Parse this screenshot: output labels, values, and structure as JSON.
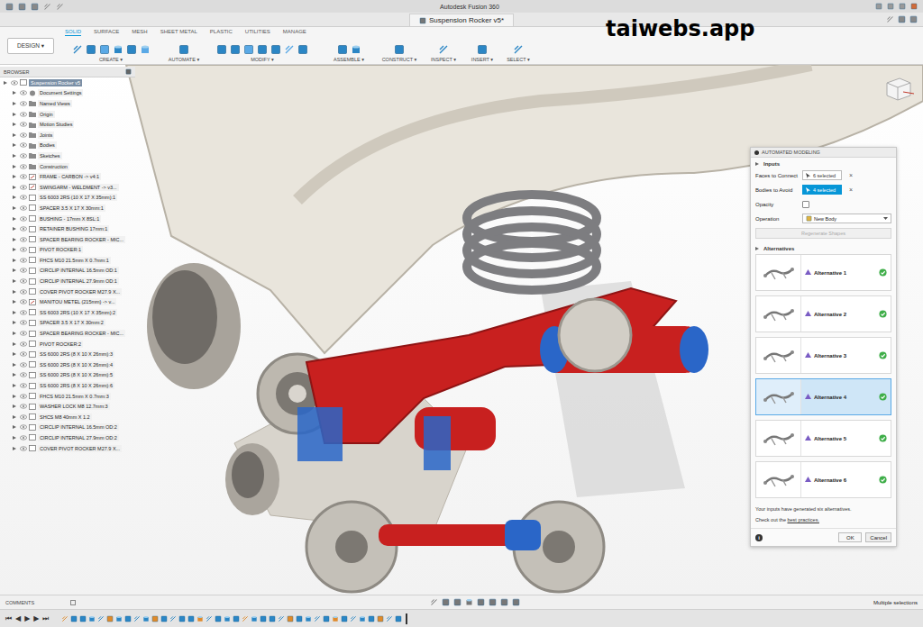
{
  "window": {
    "title": "Autodesk Fusion 360"
  },
  "document_tab": {
    "label": "Suspension Rocker v5*"
  },
  "watermark": "taiwebs.app",
  "toolbar": {
    "workspace": "DESIGN ▾",
    "tabs": [
      {
        "label": "SOLID",
        "selected": true
      },
      {
        "label": "SURFACE",
        "selected": false
      },
      {
        "label": "MESH",
        "selected": false
      },
      {
        "label": "SHEET METAL",
        "selected": false
      },
      {
        "label": "PLASTIC",
        "selected": false
      },
      {
        "label": "UTILITIES",
        "selected": false
      },
      {
        "label": "MANAGE",
        "selected": false
      }
    ],
    "groups": [
      {
        "label": "CREATE ▾"
      },
      {
        "label": "AUTOMATE ▾"
      },
      {
        "label": "MODIFY ▾"
      },
      {
        "label": "ASSEMBLE ▾"
      },
      {
        "label": "CONSTRUCT ▾"
      },
      {
        "label": "INSPECT ▾"
      },
      {
        "label": "INSERT ▾"
      },
      {
        "label": "SELECT ▾"
      }
    ]
  },
  "browser": {
    "title": "BROWSER",
    "items": [
      {
        "label": "Suspension Rocker v5",
        "kind": "root",
        "selected": true
      },
      {
        "label": "Document Settings",
        "kind": "settings",
        "selected": false
      },
      {
        "label": "Named Views",
        "kind": "folder",
        "selected": false
      },
      {
        "label": "Origin",
        "kind": "folder",
        "selected": false
      },
      {
        "label": "Motion Studies",
        "kind": "folder",
        "selected": false
      },
      {
        "label": "Joints",
        "kind": "folder",
        "selected": false
      },
      {
        "label": "Bodies",
        "kind": "folder",
        "selected": false
      },
      {
        "label": "Sketches",
        "kind": "folder",
        "selected": false
      },
      {
        "label": "Construction",
        "kind": "folder",
        "selected": false
      },
      {
        "label": "FRAME - CARBON -> v4:1",
        "kind": "link",
        "selected": false
      },
      {
        "label": "SWINGARM - WELDMENT -> v3...",
        "kind": "link",
        "selected": false
      },
      {
        "label": "SS 6003 2RS (10 X 17 X 35mm):1",
        "kind": "component",
        "selected": false
      },
      {
        "label": "SPACER 3.5 X 17 X 30mm:1",
        "kind": "component",
        "selected": false
      },
      {
        "label": "BUSHING - 17mm X 8SL:1",
        "kind": "component",
        "selected": false
      },
      {
        "label": "RETAINER BUSHING 17mm:1",
        "kind": "component",
        "selected": false
      },
      {
        "label": "SPACER BEARING ROCKER - MIC...",
        "kind": "component",
        "selected": false
      },
      {
        "label": "PIVOT ROCKER:1",
        "kind": "component",
        "selected": false
      },
      {
        "label": "FHCS M10 21.5mm X 0.7mm:1",
        "kind": "component",
        "selected": false
      },
      {
        "label": "CIRCLIP INTERNAL 16.5mm OD:1",
        "kind": "component",
        "selected": false
      },
      {
        "label": "CIRCLIP INTERNAL 27.9mm OD:1",
        "kind": "component",
        "selected": false
      },
      {
        "label": "COVER PIVOT ROCKER M27.9 X...",
        "kind": "component",
        "selected": false
      },
      {
        "label": "MANITOU METEL (215mm) -> v...",
        "kind": "link",
        "selected": false
      },
      {
        "label": "SS 6003 2RS (10 X 17 X 35mm):2",
        "kind": "component",
        "selected": false
      },
      {
        "label": "SPACER 3.5 X 17 X 30mm:2",
        "kind": "component",
        "selected": false
      },
      {
        "label": "SPACER BEARING ROCKER - MIC...",
        "kind": "component",
        "selected": false
      },
      {
        "label": "PIVOT ROCKER:2",
        "kind": "component",
        "selected": false
      },
      {
        "label": "SS 6000 2RS (8 X 10 X 26mm):3",
        "kind": "component",
        "selected": false
      },
      {
        "label": "SS 6000 2RS (8 X 10 X 26mm):4",
        "kind": "component",
        "selected": false
      },
      {
        "label": "SS 6000 2RS (8 X 10 X 26mm):5",
        "kind": "component",
        "selected": false
      },
      {
        "label": "SS 6000 2RS (8 X 10 X 26mm):6",
        "kind": "component",
        "selected": false
      },
      {
        "label": "FHCS M10 21.5mm X 0.7mm:3",
        "kind": "component",
        "selected": false
      },
      {
        "label": "WASHER LOCK M8 12.7mm:3",
        "kind": "component",
        "selected": false
      },
      {
        "label": "SHCS M8 40mm X 1.2",
        "kind": "component",
        "selected": false
      },
      {
        "label": "CIRCLIP INTERNAL 16.5mm OD:2",
        "kind": "component",
        "selected": false
      },
      {
        "label": "CIRCLIP INTERNAL 27.9mm OD:2",
        "kind": "component",
        "selected": false
      },
      {
        "label": "COVER PIVOT ROCKER M27.9 X...",
        "kind": "component",
        "selected": false
      }
    ]
  },
  "automated_modeling": {
    "title": "AUTOMATED MODELING",
    "inputs_title": "Inputs",
    "inputs": [
      {
        "label": "Faces to Connect",
        "kind": "selection",
        "value": "6 selected",
        "selected": false,
        "clear": "×"
      },
      {
        "label": "Bodies to Avoid",
        "kind": "selection",
        "value": "4 selected",
        "selected": true,
        "clear": "×"
      },
      {
        "label": "Opacity",
        "kind": "checkbox",
        "checked": false
      },
      {
        "label": "Operation",
        "kind": "dropdown",
        "value": "New Body"
      }
    ],
    "regenerate": {
      "label": "Regenerate Shapes",
      "disabled": true
    },
    "alternatives_title": "Alternatives",
    "alternatives": [
      {
        "label": "Alternative 1",
        "selected": false,
        "done": true
      },
      {
        "label": "Alternative 2",
        "selected": false,
        "done": true
      },
      {
        "label": "Alternative 3",
        "selected": false,
        "done": true
      },
      {
        "label": "Alternative 4",
        "selected": true,
        "done": true
      },
      {
        "label": "Alternative 5",
        "selected": false,
        "done": true
      },
      {
        "label": "Alternative 6",
        "selected": false,
        "done": true
      }
    ],
    "message": "Your inputs have generated six alternatives.",
    "hint": "Check out the ",
    "hint_link": "best practices.",
    "info": "i",
    "buttons": [
      {
        "label": "OK",
        "primary": true
      },
      {
        "label": "Cancel",
        "primary": false
      }
    ]
  },
  "comments": {
    "label": "COMMENTS"
  },
  "status": "Multiple selections",
  "timeline": {
    "controls": [
      "⏮",
      "◀",
      "▶",
      "▶",
      "⏭"
    ]
  }
}
